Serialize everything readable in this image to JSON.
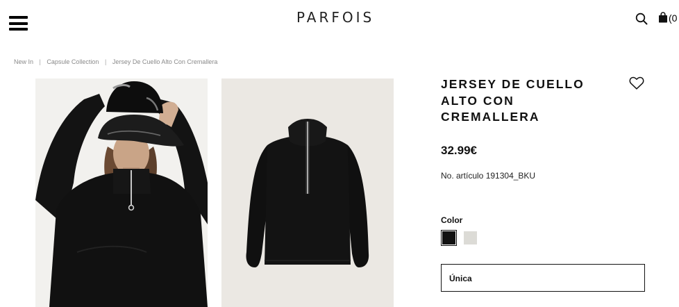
{
  "header": {
    "logo": "PARFOIS",
    "cart_count": "(0"
  },
  "breadcrumb": {
    "items": [
      "New In",
      "Capsule Collection",
      "Jersey De Cuello Alto Con Cremallera"
    ],
    "separator": "|"
  },
  "product": {
    "title": "JERSEY DE CUELLO ALTO CON CREMALLERA",
    "price": "32.99€",
    "article": "No. artículo 191304_BKU",
    "color_label": "Color",
    "colors": [
      "#111111",
      "#dcdbd6"
    ],
    "size": "Única"
  },
  "icons": {
    "menu": "hamburger-icon",
    "search": "search-icon",
    "cart": "shopping-bag-icon",
    "wishlist": "heart-icon"
  }
}
